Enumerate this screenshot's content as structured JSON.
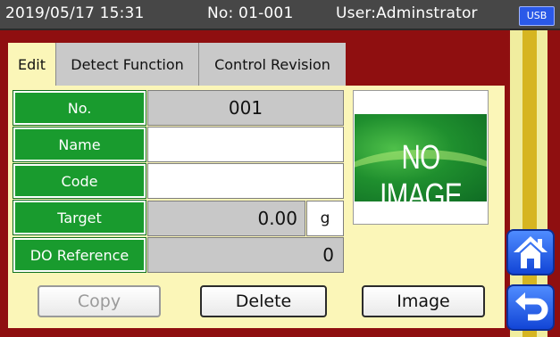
{
  "status": {
    "datetime": "2019/05/17 15:31",
    "record_no": "No: 01-001",
    "user": "User:Adminstrator",
    "usb_label": "USB"
  },
  "tabs": [
    {
      "label": "Edit",
      "active": true
    },
    {
      "label": "Detect Function",
      "active": false
    },
    {
      "label": "Control Revision",
      "active": false
    }
  ],
  "fields": {
    "no": {
      "label": "No.",
      "value": "001"
    },
    "name": {
      "label": "Name",
      "value": ""
    },
    "code": {
      "label": "Code",
      "value": ""
    },
    "target": {
      "label": "Target",
      "value": "0.00",
      "unit": "g"
    },
    "do_reference": {
      "label": "DO Reference",
      "value": "0"
    }
  },
  "image_placeholder": "NO IMAGE",
  "buttons": {
    "copy": "Copy",
    "delete": "Delete",
    "image": "Image"
  },
  "nav": {
    "home_icon": "home-icon",
    "back_icon": "return-icon"
  },
  "colors": {
    "background": "#8f0f10",
    "status_bar": "#474747",
    "panel": "#fbf6b8",
    "label_green": "#199b2e",
    "nav_blue": "#1f5ef0",
    "usb_blue": "#2a59e8"
  }
}
